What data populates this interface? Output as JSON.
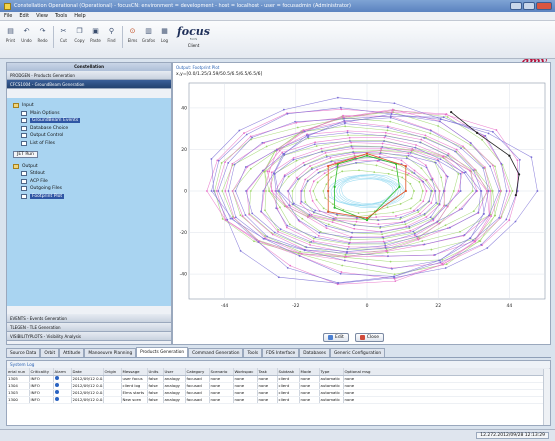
{
  "window": {
    "title": "Constellation Operational (Operational) - focusCN: environment = development - host = localhost - user = focusadmin (Administrator)"
  },
  "menu": [
    "File",
    "Edit",
    "View",
    "Tools",
    "Help"
  ],
  "toolbar": {
    "buttons": [
      {
        "label": "Print",
        "icon": "print-icon"
      },
      {
        "label": "Undo",
        "icon": "undo-icon"
      },
      {
        "label": "Redo",
        "icon": "redo-icon"
      },
      {
        "label": "Cut",
        "icon": "cut-icon"
      },
      {
        "label": "Copy",
        "icon": "copy-icon"
      },
      {
        "label": "Paste",
        "icon": "paste-icon"
      },
      {
        "label": "Find",
        "icon": "find-icon"
      },
      {
        "label": "Elms",
        "icon": "elements-icon"
      },
      {
        "label": "Grafos",
        "icon": "graph-icon"
      },
      {
        "label": "Log",
        "icon": "log-icon"
      }
    ],
    "focus_logo": "focus",
    "focus_sub": "FoCS",
    "client_label": "Client",
    "gmv_logo": "gmv"
  },
  "left_panel": {
    "title": "Constellation",
    "section": "PRODGEN - Products Generation",
    "active_item": "CFCS1004 - GroundBeam Generation",
    "tree": [
      {
        "label": "Input",
        "level": 0,
        "type": "folder"
      },
      {
        "label": "Main Options",
        "level": 1,
        "type": "doc"
      },
      {
        "label": "GroundBeam Events",
        "level": 1,
        "type": "doc",
        "selected": true
      },
      {
        "label": "Database Choice",
        "level": 1,
        "type": "doc"
      },
      {
        "label": "Output Control",
        "level": 1,
        "type": "doc"
      },
      {
        "label": "List of Files",
        "level": 1,
        "type": "doc"
      }
    ],
    "run_button": "JET Run",
    "tree_output": [
      {
        "label": "Output",
        "level": 0,
        "type": "folder"
      },
      {
        "label": "Stdout",
        "level": 1,
        "type": "doc"
      },
      {
        "label": "ACP File",
        "level": 1,
        "type": "doc"
      },
      {
        "label": "Outgoing Files",
        "level": 1,
        "type": "doc"
      },
      {
        "label": "Footprint Plot",
        "level": 1,
        "type": "doc",
        "selected": true
      }
    ],
    "bottom_sections": [
      "EVENTS - Events Generation",
      "TLEGEN - TLE Generation",
      "VISIBILITYPLOTS - Visibility Analysis"
    ]
  },
  "chart_panel": {
    "header": "Output: Footprint Plot",
    "legend": "x,y=[0.0/1.25/3.59/50.5/6.5/6.5/6.5/6]",
    "edit_label": "Edit",
    "close_label": "Close"
  },
  "chart_data": {
    "type": "line",
    "title": "",
    "xlabel": "",
    "ylabel": "",
    "xlim": [
      -55,
      55
    ],
    "ylim": [
      -52,
      52
    ],
    "x_ticks": [
      -44,
      -22,
      0,
      22,
      44
    ],
    "y_ticks": [
      -40,
      -20,
      0,
      20,
      40
    ],
    "grid": true,
    "series": [
      {
        "color": "#8ed7f0",
        "shape": "ellipse-band",
        "rx": [
          8,
          12
        ],
        "ry": [
          6,
          8
        ]
      },
      {
        "color": "#9ed66b",
        "shape": "ellipse-band",
        "rx": [
          14,
          46
        ],
        "ry": [
          10,
          38
        ]
      },
      {
        "color": "#e86fc8",
        "shape": "ellipse-band",
        "rx": [
          18,
          48
        ],
        "ry": [
          14,
          42
        ]
      },
      {
        "color": "#7b6fd6",
        "shape": "ellipse-band",
        "rx": [
          20,
          50
        ],
        "ry": [
          14,
          44
        ]
      },
      {
        "color": "#2bbb2b",
        "shape": "polygon",
        "points": [
          [
            -10,
            2
          ],
          [
            -9,
            13
          ],
          [
            0,
            17
          ],
          [
            9,
            13
          ],
          [
            10,
            2
          ],
          [
            0,
            -14
          ],
          [
            -10,
            -8
          ]
        ]
      },
      {
        "color": "#e0542a",
        "shape": "polygon",
        "points": [
          [
            -12,
            0
          ],
          [
            -12,
            12
          ],
          [
            0,
            18
          ],
          [
            12,
            12
          ],
          [
            12,
            0
          ],
          [
            0,
            -13
          ],
          [
            -12,
            -10
          ]
        ]
      },
      {
        "color": "#222222",
        "shape": "polyline",
        "points": [
          [
            26,
            38
          ],
          [
            34,
            28
          ],
          [
            44,
            17
          ],
          [
            47,
            8
          ],
          [
            46,
            -2
          ]
        ]
      }
    ]
  },
  "tabs": [
    {
      "label": "Source Data"
    },
    {
      "label": "Orbit"
    },
    {
      "label": "Attitude"
    },
    {
      "label": "Manoeuvre Planning"
    },
    {
      "label": "Products Generation",
      "active": true
    },
    {
      "label": "Command Generation"
    },
    {
      "label": "Tools"
    },
    {
      "label": "FDS Interface"
    },
    {
      "label": "Databases"
    },
    {
      "label": "Generic Configuration"
    }
  ],
  "system_log": {
    "title": "System Log",
    "columns": [
      "erial nun",
      "Criticality",
      "Alarm",
      "Date",
      "Origin",
      "Message",
      "Units",
      "User",
      "Category",
      "Scenario",
      "Workspac",
      "Task",
      "Subtask",
      "Mode",
      "Type",
      "Optional msg"
    ],
    "rows": [
      [
        "1305",
        "INFO",
        "",
        "2012/09/12 0.0.5",
        "",
        "user focus",
        "false",
        "analogy",
        "focusad",
        "none",
        "none",
        "none",
        "client",
        "none",
        "automatic",
        "none"
      ],
      [
        "1304",
        "INFO",
        "",
        "2012/09/12 0.0.5",
        "",
        "client log",
        "false",
        "analogy",
        "focusad",
        "none",
        "none",
        "none",
        "client",
        "none",
        "automatic",
        "none"
      ],
      [
        "1303",
        "INFO",
        "",
        "2012/09/12 0.0.5",
        "",
        "Elms starts",
        "false",
        "analogy",
        "focusad",
        "none",
        "none",
        "none",
        "client",
        "none",
        "automatic",
        "none"
      ],
      [
        "1300",
        "INFO",
        "",
        "2012/09/12 0.0.5",
        "",
        "New scen",
        "false",
        "analogy",
        "focusad",
        "none",
        "none",
        "none",
        "client",
        "none",
        "automatic",
        "none"
      ]
    ]
  },
  "status": {
    "timestamp": "12.272.2012/09/28 12:13:29"
  }
}
